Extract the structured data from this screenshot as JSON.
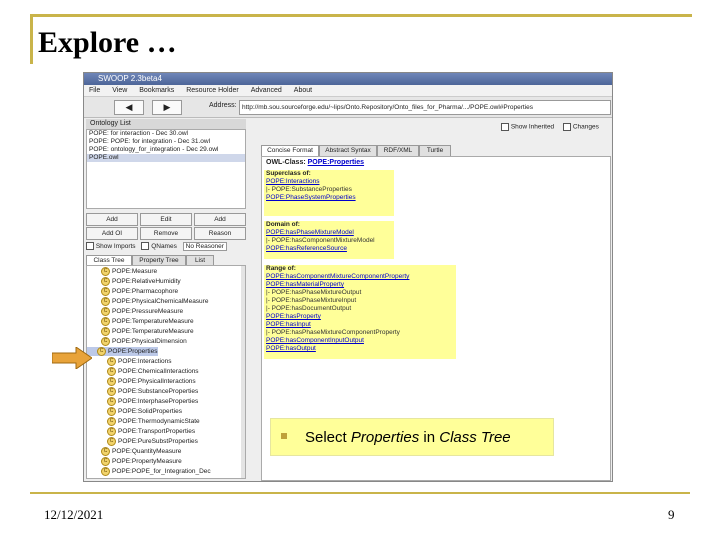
{
  "slide": {
    "title": "Explore …",
    "date": "12/12/2021",
    "page_number": "9",
    "colors": {
      "accent": "#c9b44a",
      "arrow": "#e8a33a",
      "highlight": "#ffff99"
    }
  },
  "window": {
    "title": "SWOOP 2.3beta4",
    "menu": [
      "File",
      "View",
      "Bookmarks",
      "Resource Holder",
      "Advanced",
      "About"
    ],
    "address_label": "Address:",
    "address": "http://mb.sou.sourceforge.edu/~lips/Onto.Repository/Onto_files_for_Pharma/.../POPE.owl#Properties"
  },
  "left": {
    "ontology_list_header": "Ontology List",
    "ontology_list": [
      "POPE: for interaction - Dec 30.owl",
      "POPE: POPE: for integration - Dec 31.owl",
      "POPE: ontology_for_integration - Dec 29.owl",
      "POPE.owl"
    ],
    "buttons_row1": [
      "Add",
      "Edit",
      "Add"
    ],
    "buttons_row2": [
      "Add OI",
      "Remove",
      "Reason"
    ],
    "options": {
      "show_imports": "Show Imports",
      "qnames": "QNames",
      "reasoner": "No Reasoner"
    },
    "tabs": [
      "Class Tree",
      "Property Tree",
      "List"
    ],
    "tree": [
      {
        "label": "POPE:Measure",
        "sel": false
      },
      {
        "label": "POPE:RelativeHumidity",
        "sel": false
      },
      {
        "label": "POPE:Pharmacophore",
        "sel": false
      },
      {
        "label": "POPE:PhysicalChemicalMeasure",
        "sel": false
      },
      {
        "label": "POPE:PressureMeasure",
        "sel": false
      },
      {
        "label": "POPE:TemperatureMeasure",
        "sel": false
      },
      {
        "label": "POPE:TemperatureMeasure",
        "sel": false
      },
      {
        "label": "POPE:PhysicalDimension",
        "sel": false
      },
      {
        "label": "POPE:Properties",
        "sel": true
      },
      {
        "label": "POPE:Interactions",
        "sel": false
      },
      {
        "label": "POPE:ChemicalInteractions",
        "sel": false
      },
      {
        "label": "POPE:PhysicalInteractions",
        "sel": false
      },
      {
        "label": "POPE:SubstanceProperties",
        "sel": false
      },
      {
        "label": "POPE:InterphaseProperties",
        "sel": false
      },
      {
        "label": "POPE:SolidProperties",
        "sel": false
      },
      {
        "label": "POPE:ThermodynamicState",
        "sel": false
      },
      {
        "label": "POPE:TransportProperties",
        "sel": false
      },
      {
        "label": "POPE:PureSubstProperties",
        "sel": false
      },
      {
        "label": "POPE:QuantityMeasure",
        "sel": false
      },
      {
        "label": "POPE:PropertyMeasure",
        "sel": false
      },
      {
        "label": "POPE:POPE_for_Integration_Dec",
        "sel": false
      }
    ]
  },
  "right": {
    "checks": [
      "Show Inherited",
      "Changes"
    ],
    "tabs": [
      "Concise Format",
      "Abstract Syntax",
      "RDF/XML",
      "Turtle"
    ],
    "owl_class_label": "OWL-Class:",
    "owl_class_name": "POPE:Properties",
    "superclass": {
      "header": "Superclass of:",
      "lines": [
        {
          "kind": "l",
          "text": "POPE:Interactions"
        },
        {
          "kind": "p",
          "text": "|- POPE:SubstanceProperties"
        },
        {
          "kind": "l",
          "text": "POPE:PhaseSystemProperties"
        }
      ]
    },
    "domain": {
      "header": "Domain of:",
      "lines": [
        {
          "kind": "l",
          "text": "POPE:hasPhaseMixtureModel"
        },
        {
          "kind": "p",
          "text": "|- POPE:hasComponentMixtureModel"
        },
        {
          "kind": "l",
          "text": "POPE:hasReferenceSource"
        }
      ]
    },
    "range": {
      "header": "Range of:",
      "lines": [
        {
          "kind": "l",
          "text": "POPE:hasComponentMixtureComponentProperty"
        },
        {
          "kind": "l",
          "text": "POPE:hasMaterialProperty"
        },
        {
          "kind": "p",
          "text": "|- POPE:hasPhaseMixtureOutput"
        },
        {
          "kind": "p",
          "text": "|- POPE:hasPhaseMixtureInput"
        },
        {
          "kind": "p",
          "text": "|- POPE:hasDocumentOutput"
        },
        {
          "kind": "l",
          "text": "POPE:hasProperty"
        },
        {
          "kind": "l",
          "text": "POPE:hasInput"
        },
        {
          "kind": "p",
          "text": "|- POPE:hasPhaseMixtureComponentProperty"
        },
        {
          "kind": "l",
          "text": "POPE:hasComponentInputOutput"
        },
        {
          "kind": "l",
          "text": "POPE:hasOutput"
        }
      ]
    }
  },
  "callout": {
    "prefix": "Select ",
    "italic1": "Properties",
    "middle": " in ",
    "italic2": "Class Tree"
  }
}
